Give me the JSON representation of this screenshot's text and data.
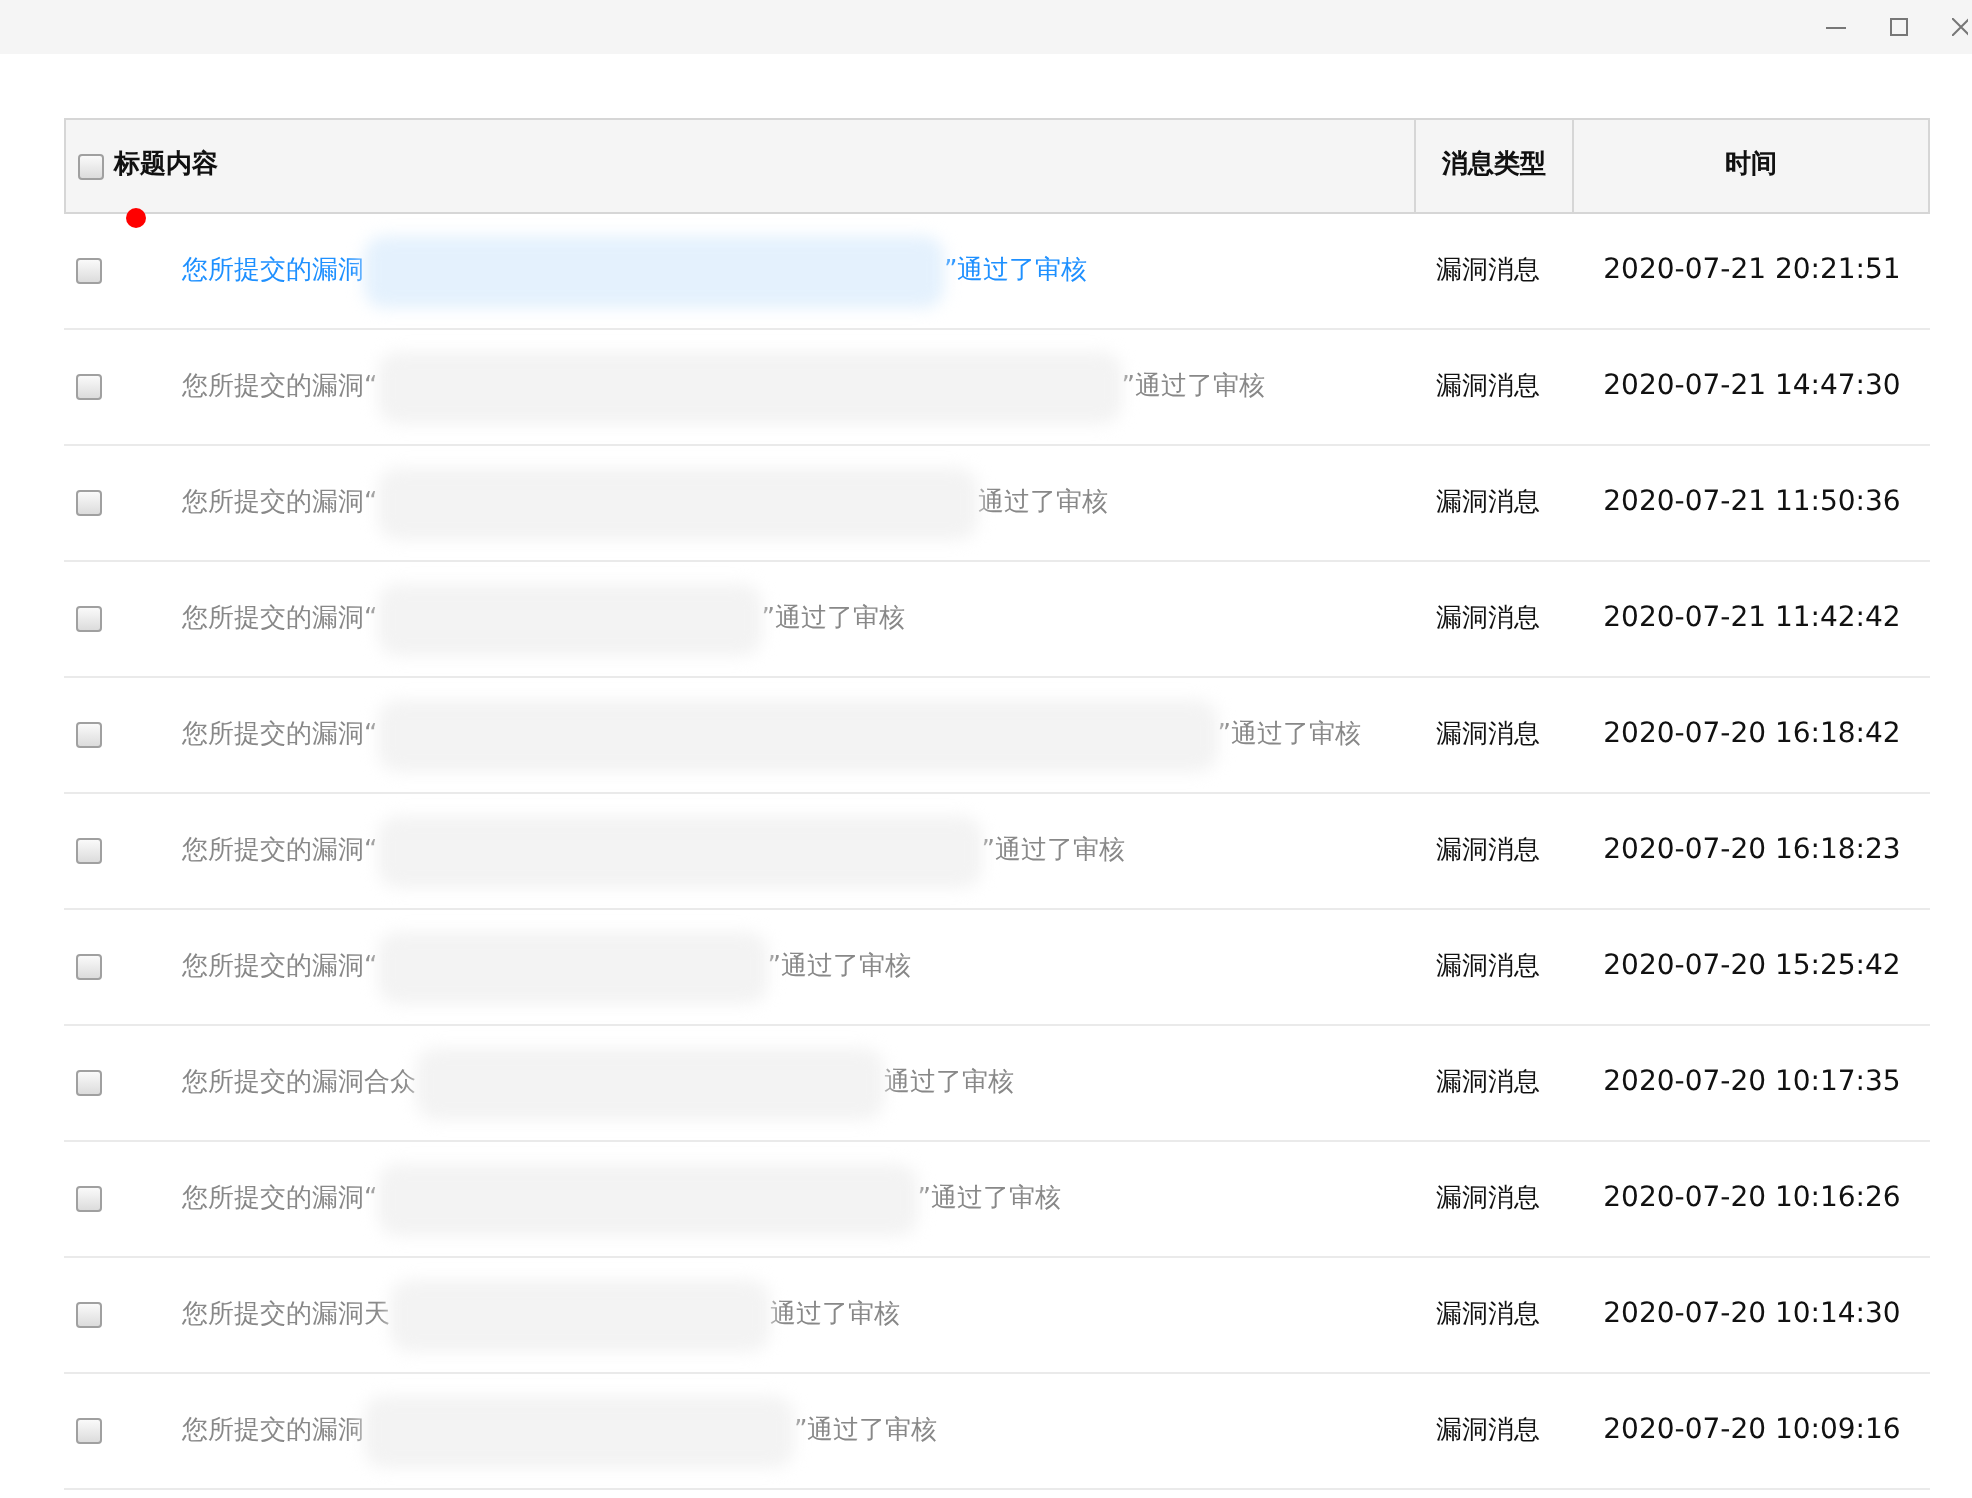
{
  "table": {
    "header_checkbox": {
      "checked": false
    },
    "columns": [
      "标题内容",
      "消息类型",
      "时间"
    ],
    "rows": [
      {
        "checked": false,
        "unread": true,
        "title_start": "您所提交的漏洞",
        "title_end": "”通过了审核",
        "type": "漏洞消息",
        "time": "2020-07-21 20:21:51"
      },
      {
        "checked": false,
        "unread": false,
        "title_start": "您所提交的漏洞“",
        "title_end": "”通过了审核",
        "type": "漏洞消息",
        "time": "2020-07-21 14:47:30"
      },
      {
        "checked": false,
        "unread": false,
        "title_start": "您所提交的漏洞“",
        "title_end": "通过了审核",
        "type": "漏洞消息",
        "time": "2020-07-21 11:50:36"
      },
      {
        "checked": false,
        "unread": false,
        "title_start": "您所提交的漏洞“",
        "title_end": "”通过了审核",
        "type": "漏洞消息",
        "time": "2020-07-21 11:42:42"
      },
      {
        "checked": false,
        "unread": false,
        "title_start": "您所提交的漏洞“",
        "title_end": "”通过了审核",
        "type": "漏洞消息",
        "time": "2020-07-20 16:18:42"
      },
      {
        "checked": false,
        "unread": false,
        "title_start": "您所提交的漏洞“",
        "title_end": "”通过了审核",
        "type": "漏洞消息",
        "time": "2020-07-20 16:18:23"
      },
      {
        "checked": false,
        "unread": false,
        "title_start": "您所提交的漏洞“",
        "title_end": "”通过了审核",
        "type": "漏洞消息",
        "time": "2020-07-20 15:25:42"
      },
      {
        "checked": false,
        "unread": false,
        "title_start": "您所提交的漏洞合众",
        "title_end": "通过了审核",
        "type": "漏洞消息",
        "time": "2020-07-20 10:17:35"
      },
      {
        "checked": false,
        "unread": false,
        "title_start": "您所提交的漏洞“",
        "title_end": "”通过了审核",
        "type": "漏洞消息",
        "time": "2020-07-20 10:16:26"
      },
      {
        "checked": false,
        "unread": false,
        "title_start": "您所提交的漏洞天",
        "title_end": "通过了审核",
        "type": "漏洞消息",
        "time": "2020-07-20 10:14:30"
      },
      {
        "checked": false,
        "unread": false,
        "title_start": "您所提交的漏洞",
        "title_end": "”通过了审核",
        "type": "漏洞消息",
        "time": "2020-07-20 10:09:16"
      }
    ]
  }
}
